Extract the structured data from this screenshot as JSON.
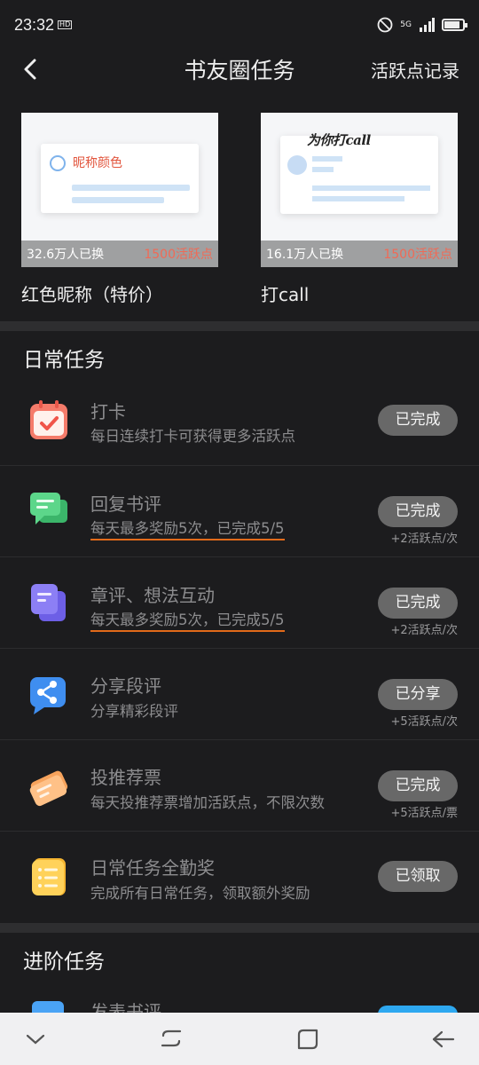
{
  "status_bar": {
    "time": "23:32",
    "hd": "HD",
    "network": "5G",
    "battery_level": 0.85
  },
  "nav": {
    "title": "书友圈任务",
    "record": "活跃点记录"
  },
  "cards": [
    {
      "thumb_text": "昵称颜色",
      "count": "32.6万人已换",
      "points": "1500活跃点",
      "name": "红色昵称（特价）"
    },
    {
      "thumb_text": "为你打call",
      "count": "16.1万人已换",
      "points": "1500活跃点",
      "name": "打call"
    }
  ],
  "daily": {
    "title": "日常任务",
    "tasks": [
      {
        "icon": "calendar-check-icon",
        "title": "打卡",
        "desc": "每日连续打卡可获得更多活跃点",
        "button": "已完成",
        "reward": ""
      },
      {
        "icon": "chat-bubble-icon",
        "title": "回复书评",
        "desc": "每天最多奖励5次，已完成5/5",
        "button": "已完成",
        "reward": "+2活跃点/次"
      },
      {
        "icon": "document-stack-icon",
        "title": "章评、想法互动",
        "desc": "每天最多奖励5次，已完成5/5",
        "button": "已完成",
        "reward": "+2活跃点/次"
      },
      {
        "icon": "share-icon",
        "title": "分享段评",
        "desc": "分享精彩段评",
        "button": "已分享",
        "reward": "+5活跃点/次"
      },
      {
        "icon": "ticket-icon",
        "title": "投推荐票",
        "desc": "每天投推荐票增加活跃点，不限次数",
        "button": "已完成",
        "reward": "+5活跃点/票"
      },
      {
        "icon": "list-icon",
        "title": "日常任务全勤奖",
        "desc": "完成所有日常任务，领取额外奖励",
        "button": "已领取",
        "reward": ""
      }
    ]
  },
  "advanced": {
    "title": "进阶任务",
    "first_task": "发表书评"
  },
  "bottom_nav": {
    "icons": [
      "chevron-down-icon",
      "recent-apps-icon",
      "home-icon",
      "back-icon"
    ]
  }
}
